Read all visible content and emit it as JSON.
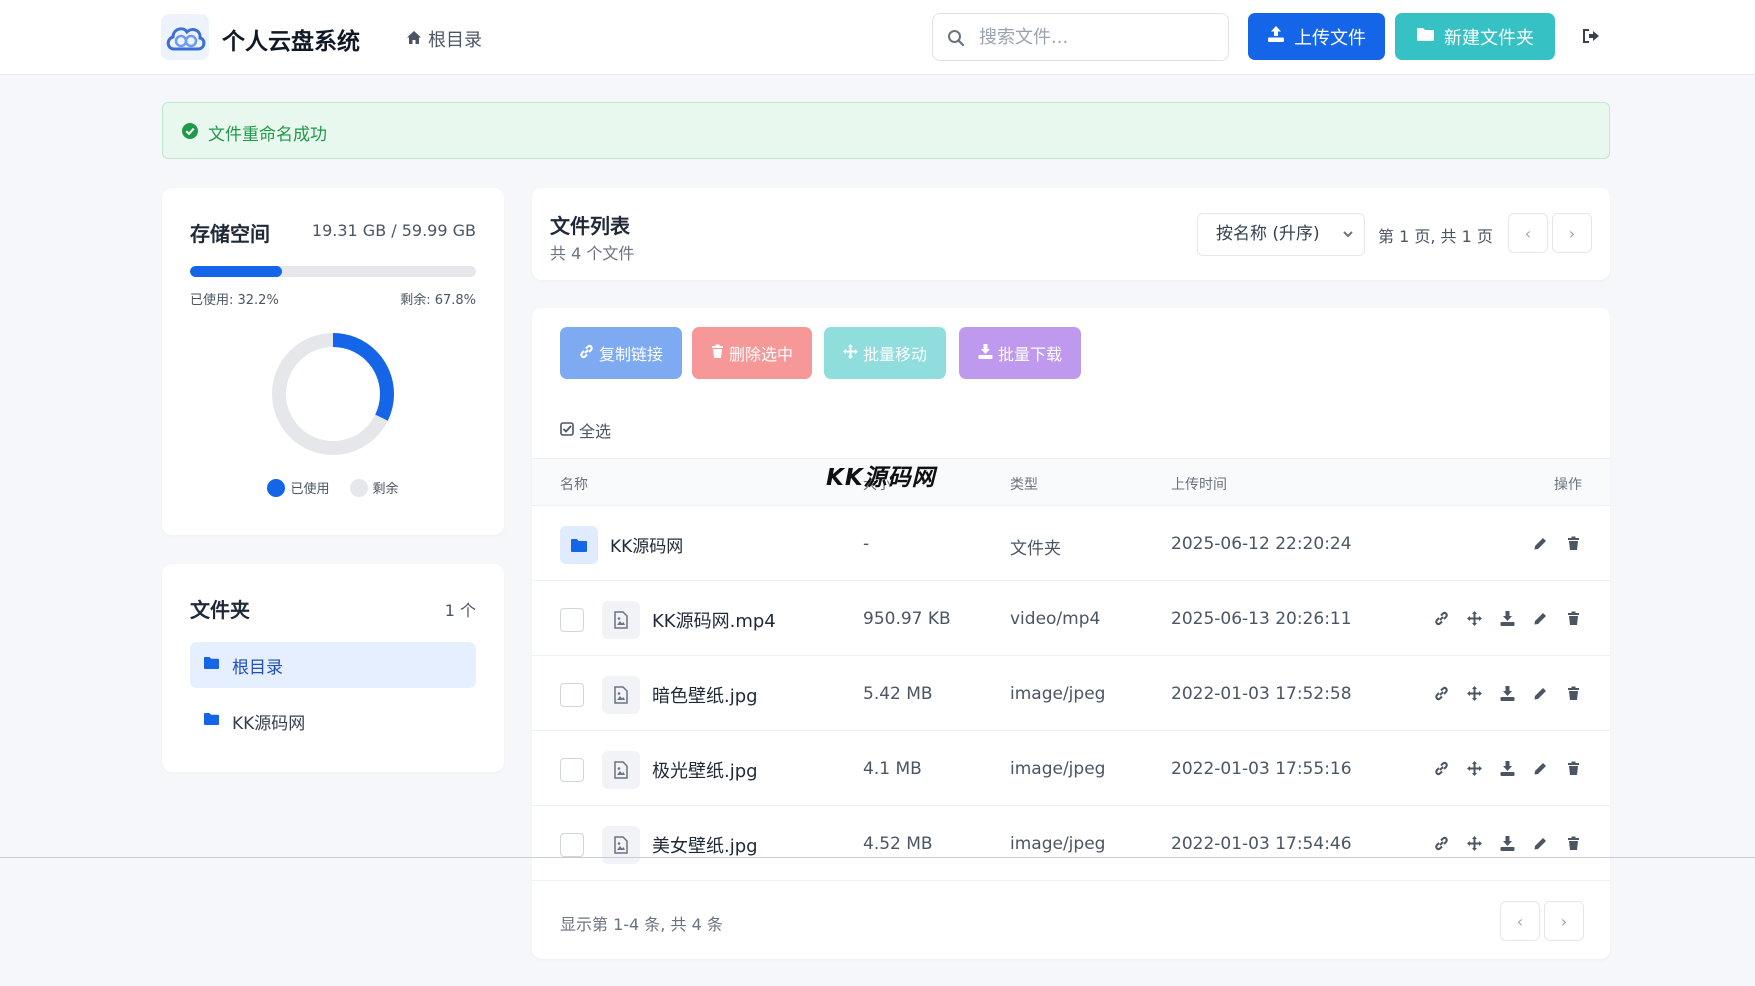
{
  "app": {
    "title": "个人云盘系统"
  },
  "header": {
    "breadcrumb": "根目录",
    "search_placeholder": "搜索文件...",
    "upload_label": "上传文件",
    "new_folder_label": "新建文件夹"
  },
  "alert": {
    "text": "文件重命名成功"
  },
  "storage": {
    "title": "存储空间",
    "size_text": "19.31 GB / 59.99 GB",
    "used_fraction": 0.322,
    "used_text": "已使用: 32.2%",
    "free_text": "剩余: 67.8%",
    "legend_used": "已使用",
    "legend_free": "剩余",
    "colors": {
      "used": "#1565e8",
      "free": "#e5e7eb"
    }
  },
  "folders": {
    "title": "文件夹",
    "count": "1 个",
    "items": [
      {
        "label": "根目录",
        "active": true
      },
      {
        "label": "KK源码网",
        "active": false
      }
    ]
  },
  "filelist": {
    "title": "文件列表",
    "subtitle": "共 4 个文件",
    "sort_label": "按名称 (升序)",
    "page_info": "第 1 页, 共 1 页",
    "actions": {
      "copy": "复制链接",
      "delete": "删除选中",
      "move": "批量移动",
      "download": "批量下载"
    },
    "select_all": "全选",
    "columns": {
      "name": "名称",
      "size": "大小",
      "type": "类型",
      "uploaded": "上传时间",
      "ops": "操作"
    },
    "rows": [
      {
        "name": "KK源码网",
        "size": "-",
        "type": "文件夹",
        "uploaded": "2025-06-12 22:20:24",
        "kind": "folder"
      },
      {
        "name": "KK源码网.mp4",
        "size": "950.97 KB",
        "type": "video/mp4",
        "uploaded": "2025-06-13 20:26:11",
        "kind": "file"
      },
      {
        "name": "暗色壁纸.jpg",
        "size": "5.42 MB",
        "type": "image/jpeg",
        "uploaded": "2022-01-03 17:52:58",
        "kind": "file"
      },
      {
        "name": "极光壁纸.jpg",
        "size": "4.1 MB",
        "type": "image/jpeg",
        "uploaded": "2022-01-03 17:55:16",
        "kind": "file"
      },
      {
        "name": "美女壁纸.jpg",
        "size": "4.52 MB",
        "type": "image/jpeg",
        "uploaded": "2022-01-03 17:54:46",
        "kind": "file"
      }
    ],
    "footer_info": "显示第 1-4 条, 共 4 条"
  },
  "watermark": "KK源码网"
}
